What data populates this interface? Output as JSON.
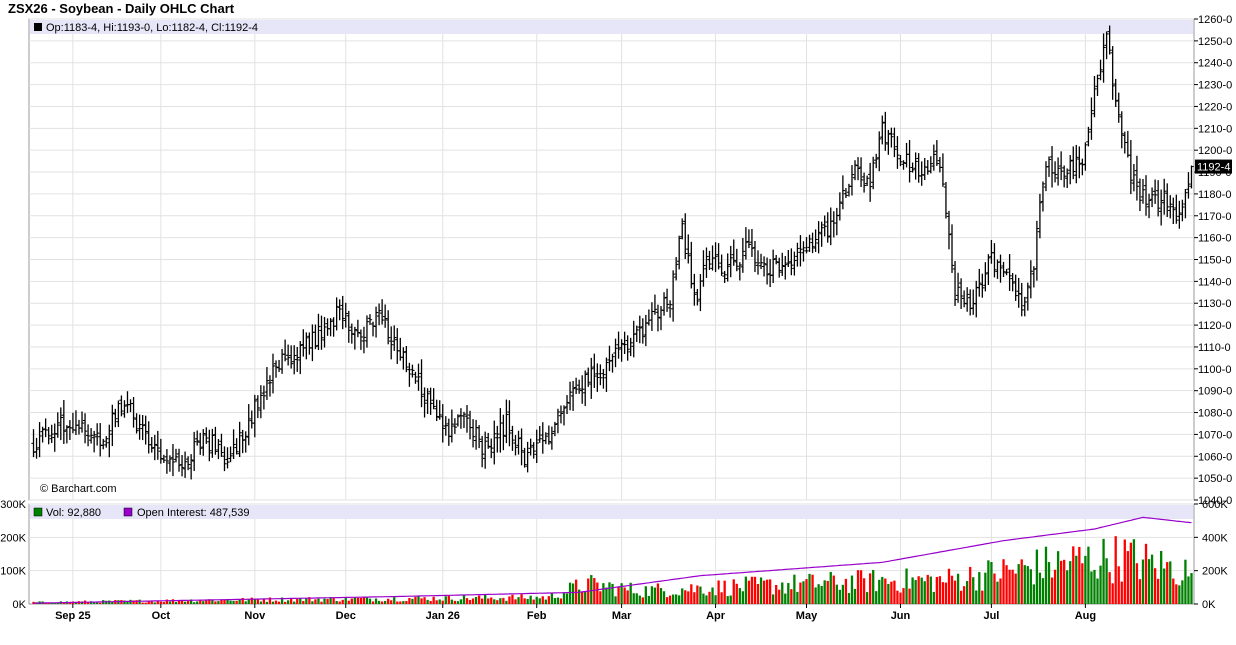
{
  "title": "ZSX26 - Soybean - Daily OHLC Chart",
  "price_info": "Op:1183-4, Hi:1193-0, Lo:1182-4, Cl:1192-4",
  "vol_info": "Vol: 92,880",
  "oi_info": "Open Interest: 487,539",
  "credit": "© Barchart.com",
  "last_price_label": "1192-4",
  "colors": {
    "bar": "#000000",
    "grid": "#e2e2e2",
    "info_band": "#e6e6f8",
    "vol_up": "#008000",
    "vol_down": "#ff0000",
    "open_interest": "#9900cc",
    "last_price_bg": "#000000"
  },
  "chart_data": [
    {
      "type": "ohlc",
      "title": "ZSX26 - Soybean - Daily OHLC Chart",
      "y_ticks": [
        "1040-0",
        "1050-0",
        "1060-0",
        "1070-0",
        "1080-0",
        "1090-0",
        "1100-0",
        "1110-0",
        "1120-0",
        "1130-0",
        "1140-0",
        "1150-0",
        "1160-0",
        "1170-0",
        "1180-0",
        "1190-0",
        "1200-0",
        "1210-0",
        "1220-0",
        "1230-0",
        "1240-0",
        "1250-0",
        "1260-0"
      ],
      "ylim": [
        1040,
        1260
      ],
      "x_tick_labels": [
        "Sep 25",
        "Oct",
        "Nov",
        "Dec",
        "Jan 26",
        "Feb",
        "Mar",
        "Apr",
        "May",
        "Jun",
        "Jul",
        "Aug"
      ],
      "grid": true,
      "last": {
        "open": 1183.5,
        "high": 1193.0,
        "low": 1182.5,
        "close": 1192.5
      },
      "close_path": [
        {
          "t": 0,
          "v": 1065
        },
        {
          "t": 10,
          "v": 1075
        },
        {
          "t": 22,
          "v": 1068
        },
        {
          "t": 30,
          "v": 1085
        },
        {
          "t": 40,
          "v": 1062
        },
        {
          "t": 48,
          "v": 1055
        },
        {
          "t": 56,
          "v": 1070
        },
        {
          "t": 64,
          "v": 1058
        },
        {
          "t": 72,
          "v": 1078
        },
        {
          "t": 80,
          "v": 1102
        },
        {
          "t": 90,
          "v": 1110
        },
        {
          "t": 100,
          "v": 1125
        },
        {
          "t": 108,
          "v": 1115
        },
        {
          "t": 114,
          "v": 1127
        },
        {
          "t": 120,
          "v": 1108
        },
        {
          "t": 128,
          "v": 1090
        },
        {
          "t": 136,
          "v": 1070
        },
        {
          "t": 142,
          "v": 1082
        },
        {
          "t": 148,
          "v": 1063
        },
        {
          "t": 156,
          "v": 1075
        },
        {
          "t": 162,
          "v": 1060
        },
        {
          "t": 170,
          "v": 1068
        },
        {
          "t": 178,
          "v": 1090
        },
        {
          "t": 186,
          "v": 1098
        },
        {
          "t": 194,
          "v": 1110
        },
        {
          "t": 202,
          "v": 1120
        },
        {
          "t": 210,
          "v": 1132
        },
        {
          "t": 214,
          "v": 1165
        },
        {
          "t": 218,
          "v": 1130
        },
        {
          "t": 222,
          "v": 1150
        },
        {
          "t": 228,
          "v": 1145
        },
        {
          "t": 236,
          "v": 1155
        },
        {
          "t": 242,
          "v": 1145
        },
        {
          "t": 250,
          "v": 1150
        },
        {
          "t": 258,
          "v": 1160
        },
        {
          "t": 264,
          "v": 1165
        },
        {
          "t": 270,
          "v": 1190
        },
        {
          "t": 276,
          "v": 1185
        },
        {
          "t": 280,
          "v": 1208
        },
        {
          "t": 286,
          "v": 1198
        },
        {
          "t": 292,
          "v": 1190
        },
        {
          "t": 298,
          "v": 1196
        },
        {
          "t": 302,
          "v": 1165
        },
        {
          "t": 304,
          "v": 1135
        },
        {
          "t": 310,
          "v": 1130
        },
        {
          "t": 316,
          "v": 1150
        },
        {
          "t": 322,
          "v": 1140
        },
        {
          "t": 326,
          "v": 1130
        },
        {
          "t": 330,
          "v": 1150
        },
        {
          "t": 334,
          "v": 1195
        },
        {
          "t": 340,
          "v": 1190
        },
        {
          "t": 346,
          "v": 1195
        },
        {
          "t": 350,
          "v": 1225
        },
        {
          "t": 354,
          "v": 1250
        },
        {
          "t": 358,
          "v": 1215
        },
        {
          "t": 362,
          "v": 1188
        },
        {
          "t": 368,
          "v": 1175
        },
        {
          "t": 374,
          "v": 1178
        },
        {
          "t": 378,
          "v": 1170
        },
        {
          "t": 382,
          "v": 1192.5
        }
      ]
    },
    {
      "type": "bar",
      "subtype": "volume_and_open_interest",
      "y_ticks_left": [
        "0K",
        "100K",
        "200K",
        "300K"
      ],
      "ylim_left": [
        0,
        300000
      ],
      "y_ticks_right": [
        "0K",
        "200K",
        "400K",
        "600K"
      ],
      "ylim_right": [
        0,
        600000
      ],
      "last_volume": 92880,
      "last_open_interest": 487539,
      "open_interest_path": [
        {
          "t": 0,
          "v": 5000
        },
        {
          "t": 60,
          "v": 25000
        },
        {
          "t": 120,
          "v": 45000
        },
        {
          "t": 180,
          "v": 70000
        },
        {
          "t": 220,
          "v": 170000
        },
        {
          "t": 250,
          "v": 210000
        },
        {
          "t": 280,
          "v": 250000
        },
        {
          "t": 320,
          "v": 380000
        },
        {
          "t": 350,
          "v": 450000
        },
        {
          "t": 366,
          "v": 520000
        },
        {
          "t": 382,
          "v": 487539
        }
      ],
      "volume_path": [
        {
          "t": 0,
          "v": 5000
        },
        {
          "t": 60,
          "v": 12000
        },
        {
          "t": 100,
          "v": 15000
        },
        {
          "t": 170,
          "v": 20000
        },
        {
          "t": 182,
          "v": 60000
        },
        {
          "t": 200,
          "v": 40000
        },
        {
          "t": 240,
          "v": 55000
        },
        {
          "t": 280,
          "v": 70000
        },
        {
          "t": 300,
          "v": 70000
        },
        {
          "t": 330,
          "v": 110000
        },
        {
          "t": 345,
          "v": 130000
        },
        {
          "t": 360,
          "v": 140000
        },
        {
          "t": 382,
          "v": 92880
        }
      ]
    }
  ]
}
